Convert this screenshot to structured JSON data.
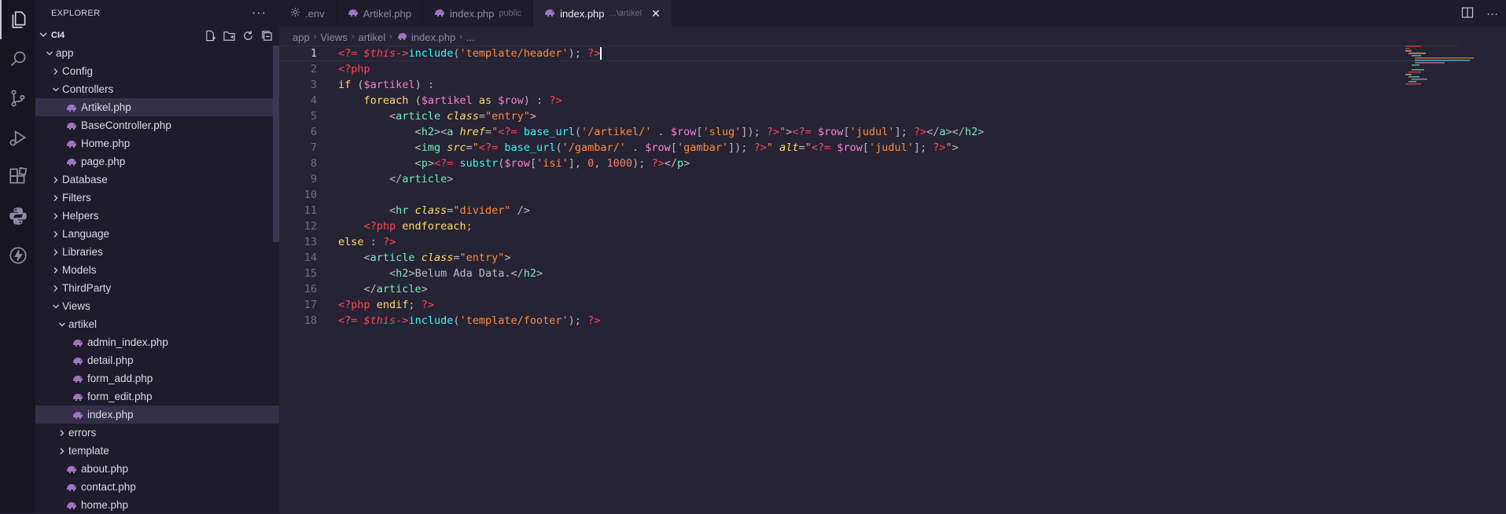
{
  "explorer": {
    "title": "EXPLORER",
    "more_label": "···",
    "root": "CI4"
  },
  "tree": [
    {
      "label": "app",
      "kind": "folder",
      "open": true,
      "depth": 0
    },
    {
      "label": "Config",
      "kind": "folder",
      "open": false,
      "depth": 1
    },
    {
      "label": "Controllers",
      "kind": "folder",
      "open": true,
      "depth": 1
    },
    {
      "label": "Artikel.php",
      "kind": "php",
      "depth": 2,
      "selected": true
    },
    {
      "label": "BaseController.php",
      "kind": "php",
      "depth": 2
    },
    {
      "label": "Home.php",
      "kind": "php",
      "depth": 2
    },
    {
      "label": "page.php",
      "kind": "php",
      "depth": 2
    },
    {
      "label": "Database",
      "kind": "folder",
      "open": false,
      "depth": 1
    },
    {
      "label": "Filters",
      "kind": "folder",
      "open": false,
      "depth": 1
    },
    {
      "label": "Helpers",
      "kind": "folder",
      "open": false,
      "depth": 1
    },
    {
      "label": "Language",
      "kind": "folder",
      "open": false,
      "depth": 1
    },
    {
      "label": "Libraries",
      "kind": "folder",
      "open": false,
      "depth": 1
    },
    {
      "label": "Models",
      "kind": "folder",
      "open": false,
      "depth": 1
    },
    {
      "label": "ThirdParty",
      "kind": "folder",
      "open": false,
      "depth": 1
    },
    {
      "label": "Views",
      "kind": "folder",
      "open": true,
      "depth": 1
    },
    {
      "label": "artikel",
      "kind": "folder",
      "open": true,
      "depth": 2
    },
    {
      "label": "admin_index.php",
      "kind": "php",
      "depth": 3
    },
    {
      "label": "detail.php",
      "kind": "php",
      "depth": 3
    },
    {
      "label": "form_add.php",
      "kind": "php",
      "depth": 3
    },
    {
      "label": "form_edit.php",
      "kind": "php",
      "depth": 3
    },
    {
      "label": "index.php",
      "kind": "php",
      "depth": 3,
      "selected": true
    },
    {
      "label": "errors",
      "kind": "folder",
      "open": false,
      "depth": 2
    },
    {
      "label": "template",
      "kind": "folder",
      "open": false,
      "depth": 2
    },
    {
      "label": "about.php",
      "kind": "php",
      "depth": 2
    },
    {
      "label": "contact.php",
      "kind": "php",
      "depth": 2
    },
    {
      "label": "home.php",
      "kind": "php",
      "depth": 2
    }
  ],
  "tabs": [
    {
      "label": ".env",
      "icon": "gear-icon",
      "desc": "",
      "active": false
    },
    {
      "label": "Artikel.php",
      "icon": "php-icon",
      "desc": "",
      "active": false
    },
    {
      "label": "index.php",
      "icon": "php-icon",
      "desc": "public",
      "active": false
    },
    {
      "label": "index.php",
      "icon": "php-icon",
      "desc": "...\\artikel",
      "active": true
    }
  ],
  "tab_close": "✕",
  "breadcrumb": [
    "app",
    "Views",
    "artikel",
    "index.php",
    "..."
  ],
  "code_lines": [
    "1",
    "2",
    "3",
    "4",
    "5",
    "6",
    "7",
    "8",
    "9",
    "10",
    "11",
    "12",
    "13",
    "14",
    "15",
    "16",
    "17",
    "18"
  ],
  "colors": {
    "background": "#262335",
    "sidebar": "#1e1b2b",
    "activity_bar": "#171520",
    "php_delimiter": "#fe4450",
    "keyword": "#fede5d",
    "string": "#ff8b39",
    "tag": "#72f1b8",
    "function": "#36f9f6",
    "php_icon": "#a074c4"
  }
}
